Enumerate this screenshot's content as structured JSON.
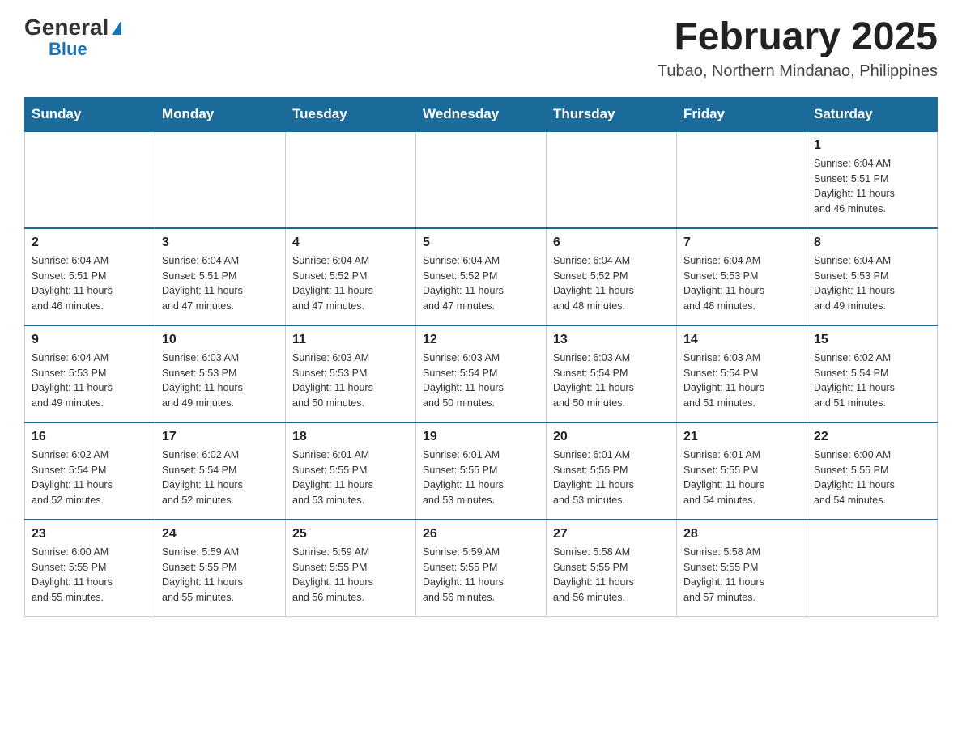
{
  "logo": {
    "general_text": "General",
    "blue_text": "Blue"
  },
  "header": {
    "month_year": "February 2025",
    "location": "Tubao, Northern Mindanao, Philippines"
  },
  "days_of_week": [
    "Sunday",
    "Monday",
    "Tuesday",
    "Wednesday",
    "Thursday",
    "Friday",
    "Saturday"
  ],
  "weeks": [
    {
      "days": [
        {
          "number": "",
          "info": ""
        },
        {
          "number": "",
          "info": ""
        },
        {
          "number": "",
          "info": ""
        },
        {
          "number": "",
          "info": ""
        },
        {
          "number": "",
          "info": ""
        },
        {
          "number": "",
          "info": ""
        },
        {
          "number": "1",
          "info": "Sunrise: 6:04 AM\nSunset: 5:51 PM\nDaylight: 11 hours\nand 46 minutes."
        }
      ]
    },
    {
      "days": [
        {
          "number": "2",
          "info": "Sunrise: 6:04 AM\nSunset: 5:51 PM\nDaylight: 11 hours\nand 46 minutes."
        },
        {
          "number": "3",
          "info": "Sunrise: 6:04 AM\nSunset: 5:51 PM\nDaylight: 11 hours\nand 47 minutes."
        },
        {
          "number": "4",
          "info": "Sunrise: 6:04 AM\nSunset: 5:52 PM\nDaylight: 11 hours\nand 47 minutes."
        },
        {
          "number": "5",
          "info": "Sunrise: 6:04 AM\nSunset: 5:52 PM\nDaylight: 11 hours\nand 47 minutes."
        },
        {
          "number": "6",
          "info": "Sunrise: 6:04 AM\nSunset: 5:52 PM\nDaylight: 11 hours\nand 48 minutes."
        },
        {
          "number": "7",
          "info": "Sunrise: 6:04 AM\nSunset: 5:53 PM\nDaylight: 11 hours\nand 48 minutes."
        },
        {
          "number": "8",
          "info": "Sunrise: 6:04 AM\nSunset: 5:53 PM\nDaylight: 11 hours\nand 49 minutes."
        }
      ]
    },
    {
      "days": [
        {
          "number": "9",
          "info": "Sunrise: 6:04 AM\nSunset: 5:53 PM\nDaylight: 11 hours\nand 49 minutes."
        },
        {
          "number": "10",
          "info": "Sunrise: 6:03 AM\nSunset: 5:53 PM\nDaylight: 11 hours\nand 49 minutes."
        },
        {
          "number": "11",
          "info": "Sunrise: 6:03 AM\nSunset: 5:53 PM\nDaylight: 11 hours\nand 50 minutes."
        },
        {
          "number": "12",
          "info": "Sunrise: 6:03 AM\nSunset: 5:54 PM\nDaylight: 11 hours\nand 50 minutes."
        },
        {
          "number": "13",
          "info": "Sunrise: 6:03 AM\nSunset: 5:54 PM\nDaylight: 11 hours\nand 50 minutes."
        },
        {
          "number": "14",
          "info": "Sunrise: 6:03 AM\nSunset: 5:54 PM\nDaylight: 11 hours\nand 51 minutes."
        },
        {
          "number": "15",
          "info": "Sunrise: 6:02 AM\nSunset: 5:54 PM\nDaylight: 11 hours\nand 51 minutes."
        }
      ]
    },
    {
      "days": [
        {
          "number": "16",
          "info": "Sunrise: 6:02 AM\nSunset: 5:54 PM\nDaylight: 11 hours\nand 52 minutes."
        },
        {
          "number": "17",
          "info": "Sunrise: 6:02 AM\nSunset: 5:54 PM\nDaylight: 11 hours\nand 52 minutes."
        },
        {
          "number": "18",
          "info": "Sunrise: 6:01 AM\nSunset: 5:55 PM\nDaylight: 11 hours\nand 53 minutes."
        },
        {
          "number": "19",
          "info": "Sunrise: 6:01 AM\nSunset: 5:55 PM\nDaylight: 11 hours\nand 53 minutes."
        },
        {
          "number": "20",
          "info": "Sunrise: 6:01 AM\nSunset: 5:55 PM\nDaylight: 11 hours\nand 53 minutes."
        },
        {
          "number": "21",
          "info": "Sunrise: 6:01 AM\nSunset: 5:55 PM\nDaylight: 11 hours\nand 54 minutes."
        },
        {
          "number": "22",
          "info": "Sunrise: 6:00 AM\nSunset: 5:55 PM\nDaylight: 11 hours\nand 54 minutes."
        }
      ]
    },
    {
      "days": [
        {
          "number": "23",
          "info": "Sunrise: 6:00 AM\nSunset: 5:55 PM\nDaylight: 11 hours\nand 55 minutes."
        },
        {
          "number": "24",
          "info": "Sunrise: 5:59 AM\nSunset: 5:55 PM\nDaylight: 11 hours\nand 55 minutes."
        },
        {
          "number": "25",
          "info": "Sunrise: 5:59 AM\nSunset: 5:55 PM\nDaylight: 11 hours\nand 56 minutes."
        },
        {
          "number": "26",
          "info": "Sunrise: 5:59 AM\nSunset: 5:55 PM\nDaylight: 11 hours\nand 56 minutes."
        },
        {
          "number": "27",
          "info": "Sunrise: 5:58 AM\nSunset: 5:55 PM\nDaylight: 11 hours\nand 56 minutes."
        },
        {
          "number": "28",
          "info": "Sunrise: 5:58 AM\nSunset: 5:55 PM\nDaylight: 11 hours\nand 57 minutes."
        },
        {
          "number": "",
          "info": ""
        }
      ]
    }
  ]
}
